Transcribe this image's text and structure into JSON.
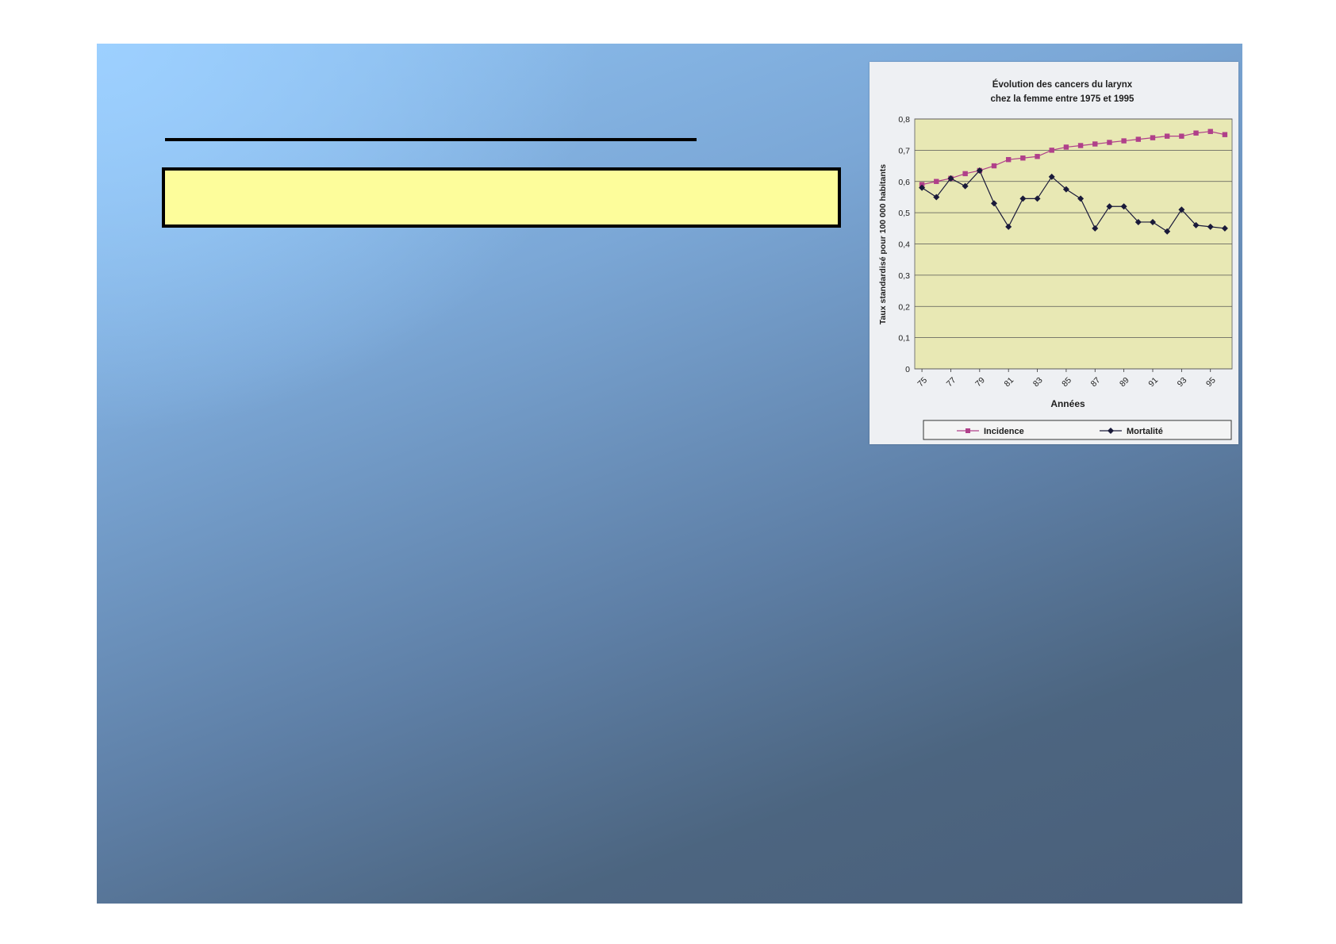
{
  "slide": {
    "box_text": ""
  },
  "chart_data": {
    "type": "line",
    "title_line1": "Évolution des cancers du larynx",
    "title_line2": "chez la femme entre 1975 et 1995",
    "xlabel": "Années",
    "ylabel": "Taux standardisé pour 100 000 habitants",
    "x": [
      75,
      76,
      77,
      78,
      79,
      80,
      81,
      82,
      83,
      84,
      85,
      86,
      87,
      88,
      89,
      90,
      91,
      92,
      93,
      94,
      95,
      96
    ],
    "x_tick_labels": [
      "75",
      "77",
      "79",
      "81",
      "83",
      "85",
      "87",
      "89",
      "91",
      "93",
      "95"
    ],
    "x_tick_values": [
      75,
      77,
      79,
      81,
      83,
      85,
      87,
      89,
      91,
      93,
      95
    ],
    "y_ticks": [
      0,
      0.1,
      0.2,
      0.3,
      0.4,
      0.5,
      0.6,
      0.7,
      0.8
    ],
    "y_tick_labels": [
      "0",
      "0,1",
      "0,2",
      "0,3",
      "0,4",
      "0,5",
      "0,6",
      "0,7",
      "0,8"
    ],
    "ylim": [
      0,
      0.8
    ],
    "grid": true,
    "legend_position": "bottom",
    "plot_background": "#e8e8b4",
    "series": [
      {
        "name": "Incidence",
        "color": "#b0408a",
        "marker": "square",
        "values": [
          0.59,
          0.6,
          0.61,
          0.625,
          0.635,
          0.65,
          0.67,
          0.675,
          0.68,
          0.7,
          0.71,
          0.715,
          0.72,
          0.725,
          0.73,
          0.735,
          0.74,
          0.745,
          0.745,
          0.755,
          0.76,
          0.75
        ]
      },
      {
        "name": "Mortalité",
        "color": "#1a1a3a",
        "marker": "diamond",
        "values": [
          0.58,
          0.55,
          0.61,
          0.585,
          0.635,
          0.53,
          0.455,
          0.545,
          0.545,
          0.615,
          0.575,
          0.545,
          0.45,
          0.52,
          0.52,
          0.47,
          0.47,
          0.44,
          0.51,
          0.46,
          0.455,
          0.45
        ]
      }
    ]
  }
}
